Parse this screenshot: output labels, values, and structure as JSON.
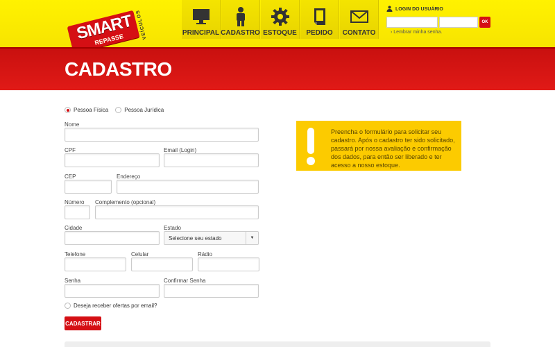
{
  "header": {
    "logo": {
      "brand": "SMART",
      "sub": "REPASSE",
      "side": "VEÍCULOS"
    },
    "nav": [
      {
        "label": "PRINCIPAL",
        "icon": "monitor-icon"
      },
      {
        "label": "CADASTRO",
        "icon": "person-icon"
      },
      {
        "label": "ESTOQUE",
        "icon": "gear-icon"
      },
      {
        "label": "PEDIDO",
        "icon": "document-icon"
      },
      {
        "label": "CONTATO",
        "icon": "envelope-icon"
      }
    ],
    "login": {
      "title": "LOGIN DO USUÁRIO",
      "ok_label": "OK",
      "forgot": "Lembrar minha senha."
    }
  },
  "banner": {
    "title": "CADASTRO"
  },
  "form": {
    "person_types": [
      {
        "label": "Pessoa Física",
        "selected": true
      },
      {
        "label": "Pessoa Jurídica",
        "selected": false
      }
    ],
    "fields": {
      "nome": "Nome",
      "cpf": "CPF",
      "email": "Email (Login)",
      "cep": "CEP",
      "endereco": "Endereço",
      "numero": "Número",
      "complemento": "Complemento (opcional)",
      "cidade": "Cidade",
      "estado": "Estado",
      "estado_value": "Selecione seu estado",
      "telefone": "Telefone",
      "celular": "Celular",
      "radio": "Rádio",
      "senha": "Senha",
      "confirmar": "Confirmar Senha"
    },
    "offers_label": "Deseja receber ofertas por email?",
    "submit_label": "CADASTRAR"
  },
  "info": {
    "text": "Preencha o formulário para solicitar seu cadastro. Após o cadastro ter sido solicitado, passará por nossa avaliação e confirmação dos dados, para então ser liberado e ter acesso a nosso estoque."
  },
  "colors": {
    "brand_yellow": "#fff200",
    "brand_red": "#d50f14",
    "info_yellow": "#fccb00"
  }
}
